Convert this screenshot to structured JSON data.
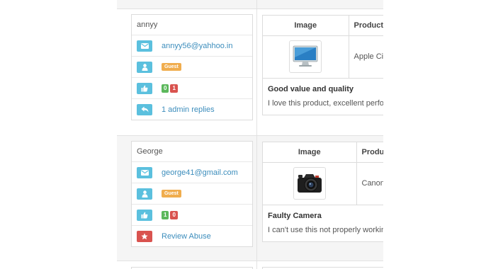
{
  "reviews": [
    {
      "customer": {
        "name": "annyy",
        "email": "annyy56@yahhoo.in",
        "type_badge": "Guest",
        "likes": "0",
        "dislikes": "1",
        "action_label": "1 admin replies",
        "action_icon": "reply-icon"
      },
      "product": {
        "col_image": "Image",
        "col_product": "Product",
        "name": "Apple Cin",
        "image": "monitor-image"
      },
      "review": {
        "title": "Good value and quality",
        "text": "I love this product, excellent perfo"
      }
    },
    {
      "customer": {
        "name": "George",
        "email": "george41@gmail.com",
        "type_badge": "Guest",
        "likes": "1",
        "dislikes": "0",
        "action_label": "Review Abuse",
        "action_icon": "star-icon"
      },
      "product": {
        "col_image": "Image",
        "col_product": "Produ",
        "name": "Canon",
        "image": "camera-image"
      },
      "review": {
        "title": "Faulty Camera",
        "text": "I can't use this not properly workin"
      }
    }
  ],
  "colors": {
    "icon_blue": "#5bc0de",
    "icon_red": "#d9534f",
    "badge_orange": "#f0ad4e",
    "badge_green": "#5cb85c",
    "link": "#3c8dbc"
  }
}
